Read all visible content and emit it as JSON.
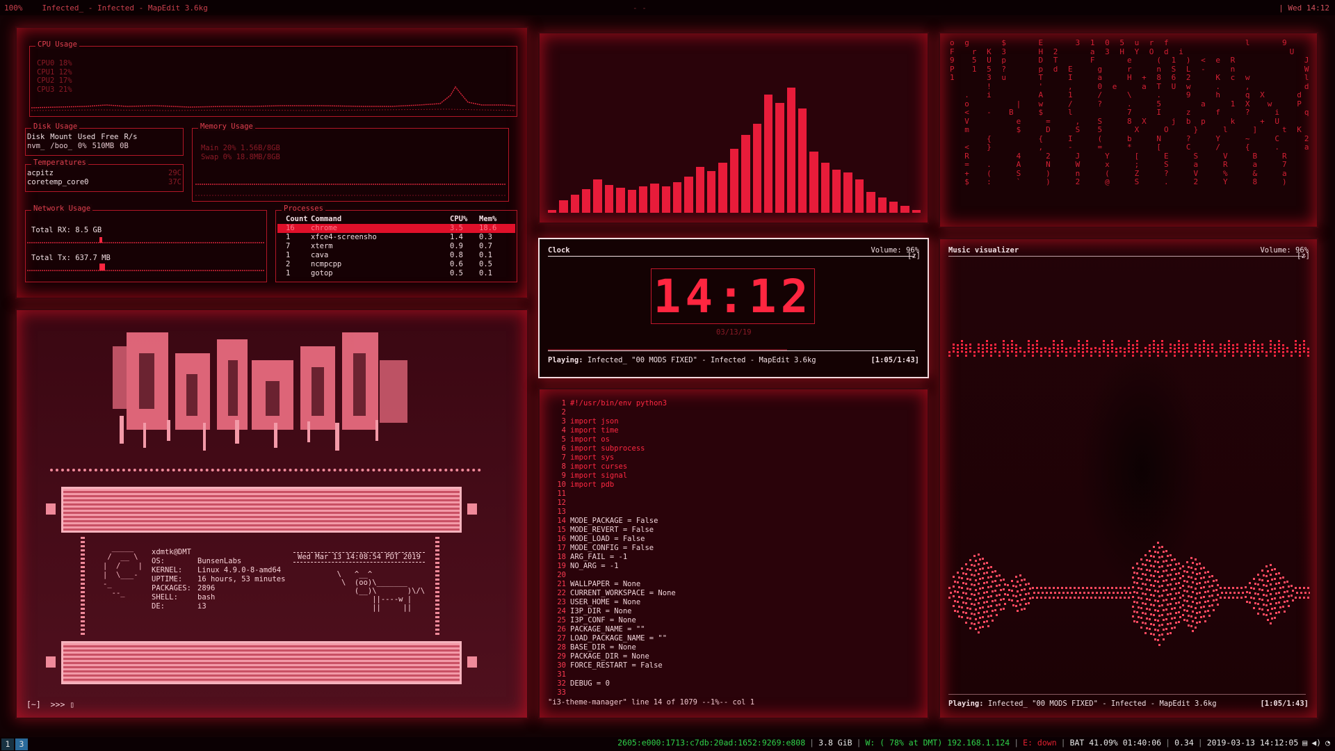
{
  "topbar": {
    "percent": "100%",
    "title": "Infected_ - Infected - MapEdit 3.6kg",
    "center": "- -",
    "clock": "| Wed 14:12"
  },
  "cpu": {
    "title": "CPU Usage",
    "cores": [
      "CPU0  18%",
      "CPU1  12%",
      "CPU2  17%",
      "CPU3  21%"
    ]
  },
  "disk": {
    "title": "Disk Usage",
    "headers": [
      "Disk",
      "Mount",
      "Used",
      "Free",
      "R/s"
    ],
    "row": [
      "nvm_",
      "/boo_",
      "0%",
      "510MB",
      "0B"
    ]
  },
  "temps": {
    "title": "Temperatures",
    "items": [
      {
        "name": "acpitz",
        "value": "29C"
      },
      {
        "name": "coretemp_core0",
        "value": "37C"
      }
    ]
  },
  "memory": {
    "title": "Memory Usage",
    "main": "Main  20%   1.56B/8GB",
    "swap": "Swap   0%  18.8MB/8GB"
  },
  "network": {
    "title": "Network Usage",
    "rx": "Total RX:   8.5 GB",
    "tx": "Total Tx: 637.7 MB"
  },
  "processes": {
    "title": "Processes",
    "headers": [
      "Count",
      "Command",
      "CPU%",
      "Mem%"
    ],
    "rows": [
      [
        "16",
        "chrome",
        "3.5",
        "18.6"
      ],
      [
        "1",
        "xfce4-screensho",
        "1.4",
        "0.3"
      ],
      [
        "7",
        "xterm",
        "0.9",
        "0.7"
      ],
      [
        "1",
        "cava",
        "0.8",
        "0.1"
      ],
      [
        "2",
        "ncmpcpp",
        "0.6",
        "0.5"
      ],
      [
        "1",
        "gotop",
        "0.5",
        "0.1"
      ]
    ]
  },
  "neofetch": {
    "user": "xdmtk@DMT",
    "info": [
      {
        "k": "OS:",
        "v": "BunsenLabs"
      },
      {
        "k": "KERNEL:",
        "v": "Linux 4.9.0-8-amd64"
      },
      {
        "k": "UPTIME:",
        "v": "16 hours, 53 minutes"
      },
      {
        "k": "PACKAGES:",
        "v": "2896"
      },
      {
        "k": "SHELL:",
        "v": "bash"
      },
      {
        "k": "DE:",
        "v": "i3"
      }
    ],
    "date": "Wed Mar 13 14:08:54 PDT 2019",
    "prompt": "[~]  >>> ▯"
  },
  "clock": {
    "title": "Clock",
    "volume": "Volume: 96%",
    "tag": "[z]",
    "time": "14:12",
    "date": "03/13/19",
    "playing_label": "Playing:",
    "playing": "Infected_ \"00 MODS FIXED\" - Infected - MapEdit 3.6kg",
    "progress": "[1:05/1:43]"
  },
  "visualizer": {
    "title": "Music visualizer",
    "volume": "Volume: 96%",
    "tag": "[z]",
    "playing_label": "Playing:",
    "playing": "Infected_ \"00 MODS FIXED\" - Infected - MapEdit 3.6kg",
    "progress": "[1:05/1:43]"
  },
  "bars": [
    4,
    18,
    26,
    34,
    48,
    40,
    36,
    33,
    38,
    42,
    38,
    44,
    52,
    66,
    60,
    72,
    92,
    112,
    128,
    170,
    158,
    180,
    150,
    88,
    72,
    62,
    58,
    48,
    30,
    22,
    16,
    10,
    4
  ],
  "editor": {
    "lines": [
      {
        "n": "1",
        "t": "#!/usr/bin/env python3",
        "kw": true
      },
      {
        "n": "2",
        "t": ""
      },
      {
        "n": "3",
        "t": "import json"
      },
      {
        "n": "4",
        "t": "import time"
      },
      {
        "n": "5",
        "t": "import os"
      },
      {
        "n": "6",
        "t": "import subprocess"
      },
      {
        "n": "7",
        "t": "import sys"
      },
      {
        "n": "8",
        "t": "import curses"
      },
      {
        "n": "9",
        "t": "import signal"
      },
      {
        "n": "10",
        "t": "import pdb"
      },
      {
        "n": "11",
        "t": ""
      },
      {
        "n": "12",
        "t": ""
      },
      {
        "n": "13",
        "t": ""
      },
      {
        "n": "14",
        "t": "MODE_PACKAGE = False"
      },
      {
        "n": "15",
        "t": "MODE_REVERT = False"
      },
      {
        "n": "16",
        "t": "MODE_LOAD = False"
      },
      {
        "n": "17",
        "t": "MODE_CONFIG = False"
      },
      {
        "n": "18",
        "t": "ARG_FAIL = -1"
      },
      {
        "n": "19",
        "t": "NO_ARG = -1"
      },
      {
        "n": "20",
        "t": ""
      },
      {
        "n": "21",
        "t": "WALLPAPER = None"
      },
      {
        "n": "22",
        "t": "CURRENT_WORKSPACE = None"
      },
      {
        "n": "23",
        "t": "USER_HOME = None"
      },
      {
        "n": "24",
        "t": "I3P_DIR = None"
      },
      {
        "n": "25",
        "t": "I3P_CONF = None"
      },
      {
        "n": "26",
        "t": "PACKAGE_NAME = \"\""
      },
      {
        "n": "27",
        "t": "LOAD_PACKAGE_NAME = \"\""
      },
      {
        "n": "28",
        "t": "BASE_DIR = None"
      },
      {
        "n": "29",
        "t": "PACKAGE_DIR = None"
      },
      {
        "n": "30",
        "t": "FORCE_RESTART = False"
      },
      {
        "n": "31",
        "t": ""
      },
      {
        "n": "32",
        "t": "DEBUG = 0"
      },
      {
        "n": "33",
        "t": ""
      }
    ],
    "status": "\"i3-theme-manager\" line 14 of 1079 --1%-- col 1"
  },
  "statusbar": {
    "workspaces": [
      "1",
      "3"
    ],
    "ipv6": "2605:e000:1713:c7db:20ad:1652:9269:e808",
    "ram": "3.8 GiB",
    "wifi": "W: ( 78% at DMT) 192.168.1.124",
    "eth": "E: down",
    "battery": "BAT 41.09% 01:40:06",
    "load": "0.34",
    "datetime": "2019-03-13 14:12:05"
  },
  "colors": {
    "accent": "#ff2640",
    "background": "#1b0205",
    "ws_active": "#2a6a9a"
  }
}
